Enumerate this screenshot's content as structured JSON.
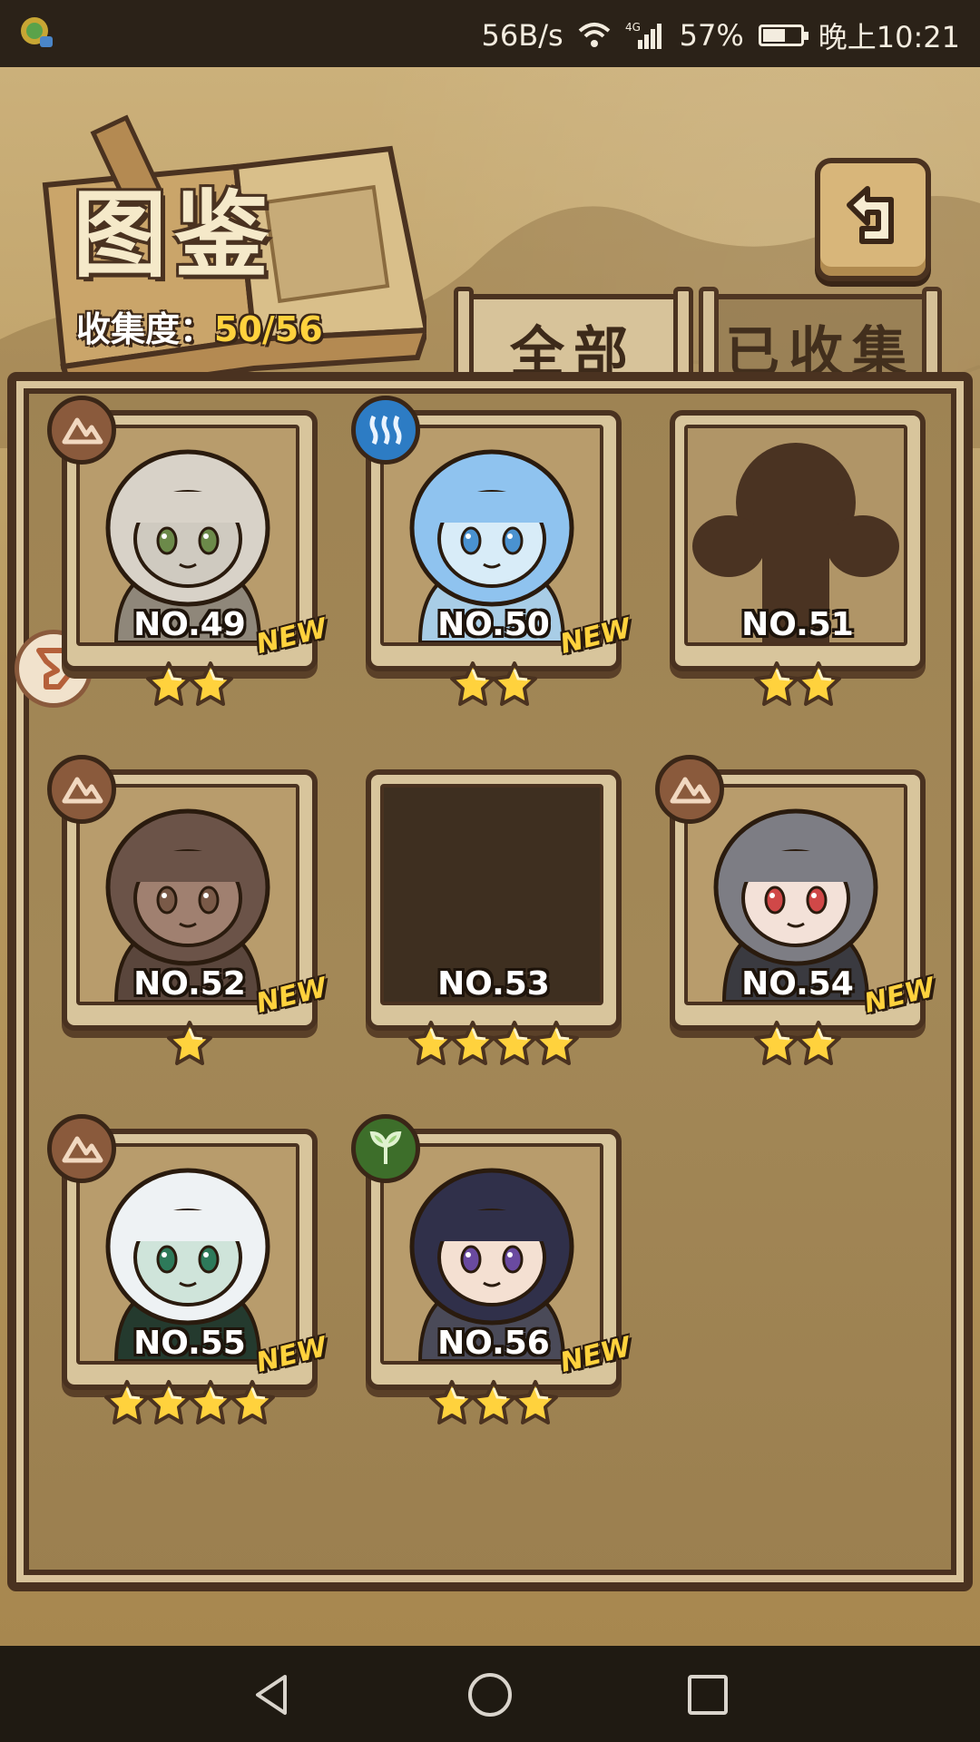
{
  "status_bar": {
    "network_speed": "56B/s",
    "signal_label": "4G",
    "battery": "57%",
    "time": "晚上10:21"
  },
  "header": {
    "title": "图鉴",
    "collection_label": "收集度：",
    "collection_value": "50/56"
  },
  "tabs": [
    {
      "label": "全部",
      "active": true
    },
    {
      "label": "已收集",
      "active": false
    }
  ],
  "cards": [
    {
      "number": "NO.49",
      "stars": 2,
      "is_new": true,
      "element": "earth",
      "collected": true,
      "new_label": "NEW"
    },
    {
      "number": "NO.50",
      "stars": 2,
      "is_new": true,
      "element": "water",
      "collected": true,
      "new_label": "NEW"
    },
    {
      "number": "NO.51",
      "stars": 2,
      "is_new": false,
      "element": "",
      "collected": false
    },
    {
      "number": "NO.52",
      "stars": 1,
      "is_new": true,
      "element": "earth",
      "collected": true,
      "new_label": "NEW"
    },
    {
      "number": "NO.53",
      "stars": 4,
      "is_new": false,
      "element": "",
      "collected": false
    },
    {
      "number": "NO.54",
      "stars": 2,
      "is_new": true,
      "element": "earth",
      "collected": true,
      "new_label": "NEW"
    },
    {
      "number": "NO.55",
      "stars": 4,
      "is_new": true,
      "element": "earth",
      "collected": true,
      "new_label": "NEW"
    },
    {
      "number": "NO.56",
      "stars": 3,
      "is_new": true,
      "element": "nature",
      "collected": true,
      "new_label": "NEW"
    }
  ],
  "colors": {
    "frame_dark": "#4a3220",
    "parchment": "#d8c59c",
    "star_gold": "#ffd23d",
    "new_gold": "#ffd23d"
  },
  "icons": {
    "back": "return-arrow-icon",
    "nav_back": "triangle-back-icon",
    "nav_home": "circle-home-icon",
    "nav_recent": "square-recent-icon"
  }
}
